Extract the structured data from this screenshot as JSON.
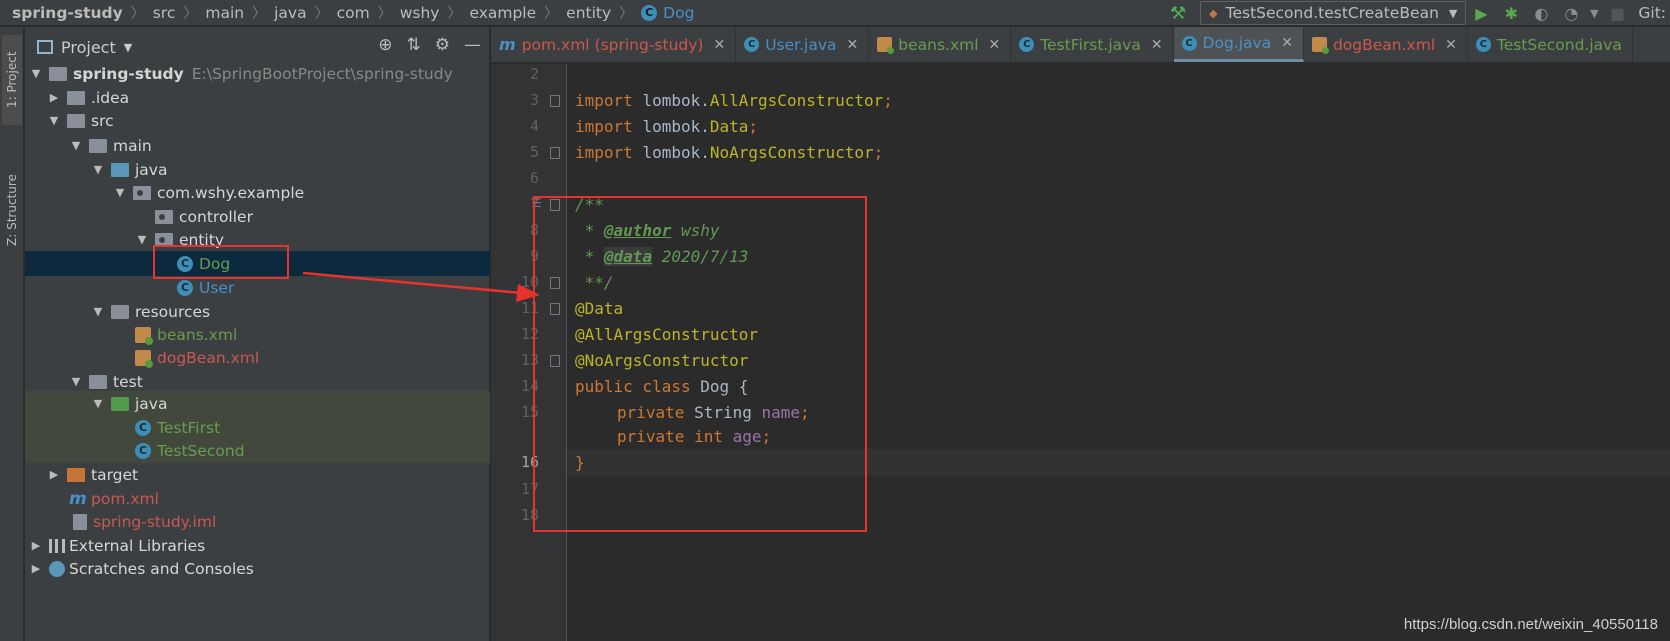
{
  "breadcrumb": {
    "items": [
      "spring-study",
      "src",
      "main",
      "java",
      "com",
      "wshy",
      "example",
      "entity",
      "Dog"
    ]
  },
  "toolbar": {
    "run_config": "TestSecond.testCreateBean",
    "git_label": "Git:"
  },
  "sidebar": {
    "project_tab": "1: Project",
    "structure_tab": "Z: Structure"
  },
  "project_panel": {
    "title": "Project",
    "tree": [
      {
        "label": "spring-study",
        "path": "E:\\SpringBootProject\\spring-study"
      },
      {
        "label": ".idea"
      },
      {
        "label": "src"
      },
      {
        "label": "main"
      },
      {
        "label": "java"
      },
      {
        "label": "com.wshy.example"
      },
      {
        "label": "controller"
      },
      {
        "label": "entity"
      },
      {
        "label": "Dog"
      },
      {
        "label": "User"
      },
      {
        "label": "resources"
      },
      {
        "label": "beans.xml"
      },
      {
        "label": "dogBean.xml"
      },
      {
        "label": "test"
      },
      {
        "label": "java"
      },
      {
        "label": "TestFirst"
      },
      {
        "label": "TestSecond"
      },
      {
        "label": "target"
      },
      {
        "label": "pom.xml"
      },
      {
        "label": "spring-study.iml"
      },
      {
        "label": "External Libraries"
      },
      {
        "label": "Scratches and Consoles"
      }
    ]
  },
  "tabs": [
    {
      "label": "pom.xml (spring-study)",
      "color": "#c9584e"
    },
    {
      "label": "User.java",
      "color": "#4b8fc7"
    },
    {
      "label": "beans.xml",
      "color": "#6a9a4f"
    },
    {
      "label": "TestFirst.java",
      "color": "#6a9a4f"
    },
    {
      "label": "Dog.java",
      "color": "#4b8fc7",
      "active": true
    },
    {
      "label": "dogBean.xml",
      "color": "#c9584e"
    },
    {
      "label": "TestSecond.java",
      "color": "#6a9a4f"
    }
  ],
  "editor": {
    "line_numbers": [
      "2",
      "3",
      "4",
      "5",
      "6",
      "7",
      "8",
      "9",
      "10",
      "11",
      "12",
      "13",
      "14",
      "15",
      "16",
      "17",
      "18"
    ],
    "current_line": "16",
    "code": {
      "l3": {
        "kw": "import",
        "pkg": "lombok.",
        "cls": "AllArgsConstructor",
        "end": ";"
      },
      "l4": {
        "kw": "import",
        "pkg": "lombok.",
        "cls": "Data",
        "end": ";"
      },
      "l5": {
        "kw": "import",
        "pkg": "lombok.",
        "cls": "NoArgsConstructor",
        "end": ";"
      },
      "l7": "/**",
      "l8": {
        "star": " * ",
        "tag": "@author",
        "val": " wshy"
      },
      "l9": {
        "star": " * ",
        "tag": "@data",
        "val": " 2020/7/13"
      },
      "l10": " **/",
      "l11": "@Data",
      "l12": "@AllArgsConstructor",
      "l13": "@NoArgsConstructor",
      "l14": {
        "kw": "public class",
        "name": " Dog {"
      },
      "l15": {
        "kw": "private",
        "type": " String ",
        "field": "name",
        "end": ";"
      },
      "l16": {
        "kw": "private int",
        "field": "age",
        "end": ";"
      },
      "l17": "}"
    }
  },
  "watermark": "https://blog.csdn.net/weixin_40550118",
  "colors": {
    "annotation_red": "#e8322e",
    "selection": "#0d293e"
  }
}
